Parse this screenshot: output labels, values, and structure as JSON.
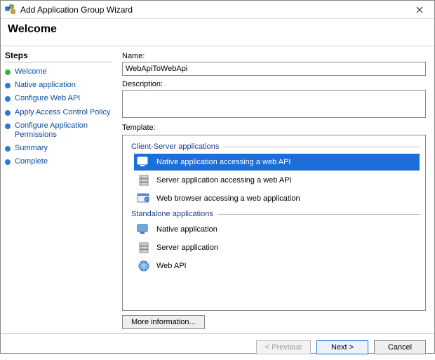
{
  "window": {
    "title": "Add Application Group Wizard"
  },
  "header": {
    "page_title": "Welcome"
  },
  "sidebar": {
    "title": "Steps",
    "items": [
      {
        "label": "Welcome",
        "current": true
      },
      {
        "label": "Native application",
        "current": false
      },
      {
        "label": "Configure Web API",
        "current": false
      },
      {
        "label": "Apply Access Control Policy",
        "current": false
      },
      {
        "label": "Configure Application Permissions",
        "current": false
      },
      {
        "label": "Summary",
        "current": false
      },
      {
        "label": "Complete",
        "current": false
      }
    ]
  },
  "form": {
    "name_label": "Name:",
    "name_value": "WebApiToWebApi",
    "description_label": "Description:",
    "description_value": "",
    "template_label": "Template:"
  },
  "templates": {
    "group1_label": "Client-Server applications",
    "group1_items": [
      {
        "label": "Native application accessing a web API",
        "icon": "native-to-api-icon",
        "selected": true
      },
      {
        "label": "Server application accessing a web API",
        "icon": "server-to-api-icon",
        "selected": false
      },
      {
        "label": "Web browser accessing a web application",
        "icon": "browser-to-app-icon",
        "selected": false
      }
    ],
    "group2_label": "Standalone applications",
    "group2_items": [
      {
        "label": "Native application",
        "icon": "native-app-icon",
        "selected": false
      },
      {
        "label": "Server application",
        "icon": "server-app-icon",
        "selected": false
      },
      {
        "label": "Web API",
        "icon": "web-api-icon",
        "selected": false
      }
    ]
  },
  "buttons": {
    "more_info": "More information...",
    "previous": "< Previous",
    "next": "Next >",
    "cancel": "Cancel"
  }
}
